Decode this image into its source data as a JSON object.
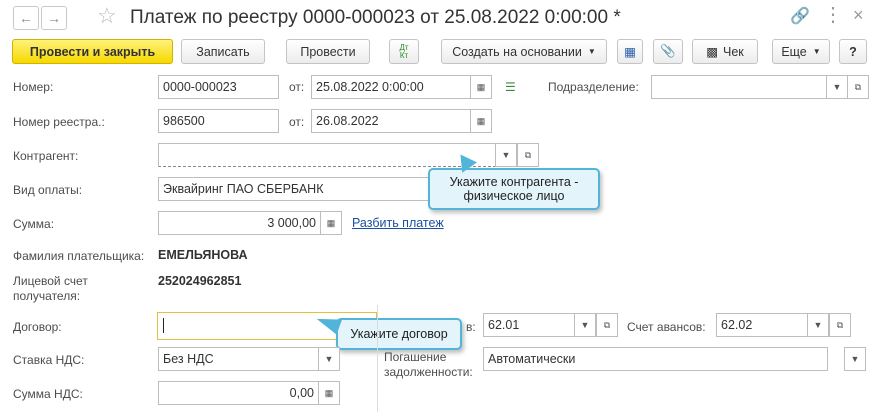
{
  "window": {
    "title": "Платеж по реестру 0000-000023 от 25.08.2022 0:00:00 *"
  },
  "toolbar": {
    "post_close": "Провести и закрыть",
    "save": "Записать",
    "post": "Провести",
    "dt_kt": "Дт\nКт",
    "create_basis": "Создать на основании",
    "check": "Чек",
    "more": "Еще",
    "help": "?"
  },
  "form": {
    "number_label": "Номер:",
    "number_value": "0000-000023",
    "from_label": "от:",
    "date_value": "25.08.2022  0:00:00",
    "division_label": "Подразделение:",
    "division_value": "",
    "registry_label": "Номер реестра.:",
    "registry_value": "986500",
    "registry_from_label": "от:",
    "registry_date": "26.08.2022",
    "counterparty_label": "Контрагент:",
    "counterparty_value": "",
    "payment_type_label": "Вид оплаты:",
    "payment_type_value": "Эквайринг ПАО СБЕРБАНК",
    "amount_label": "Сумма:",
    "amount_value": "3 000,00",
    "split_link": "Разбить платеж",
    "payer_label": "Фамилия плательщика:",
    "payer_value": "ЕМЕЛЬЯНОВА",
    "account_label": "Лицевой счет получателя:",
    "account_value": "252024962851",
    "contract_label": "Договор:",
    "contract_value": "",
    "vat_rate_label": "Ставка НДС:",
    "vat_rate_value": "Без НДС",
    "vat_amount_label": "Сумма НДС:",
    "vat_amount_value": "0,00",
    "settlement_account_label": "в:",
    "settlement_account_value": "62.01",
    "advance_account_label": "Счет авансов:",
    "advance_account_value": "62.02",
    "debt_repayment_label": "Погашение задолженности:",
    "debt_repayment_value": "Автоматически"
  },
  "tooltips": {
    "counterparty": "Укажите контрагента - физическое лицо",
    "contract": "Укажите договор"
  }
}
